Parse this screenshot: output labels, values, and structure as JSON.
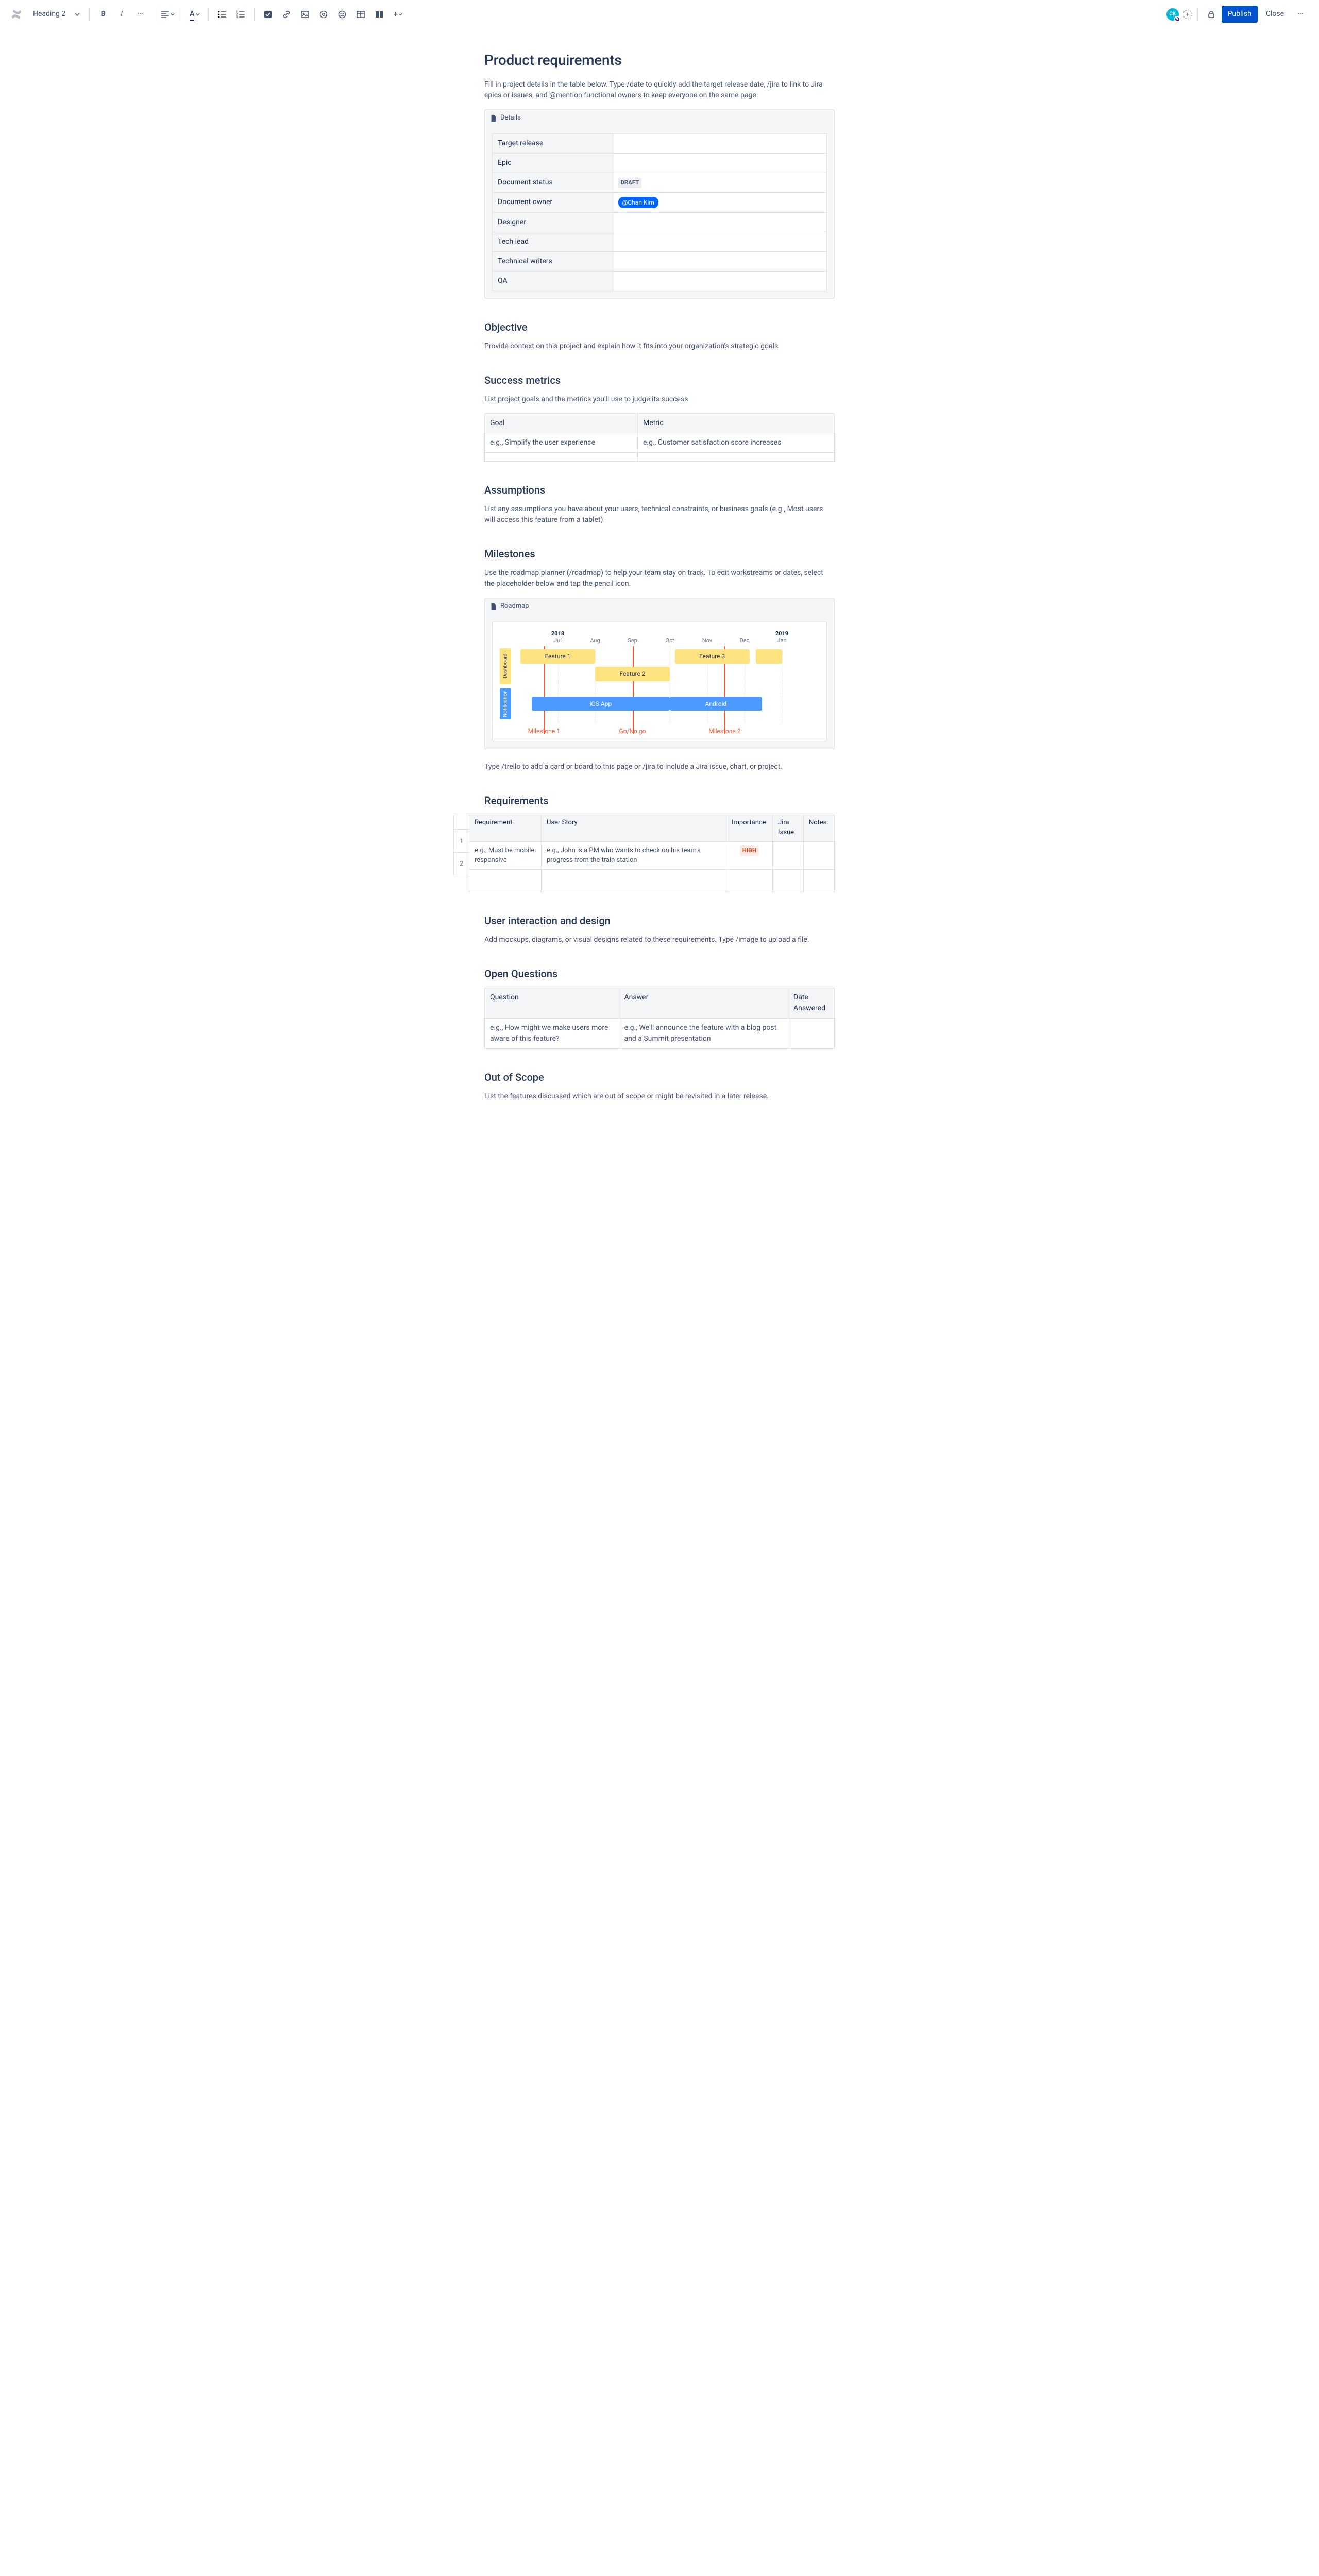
{
  "toolbar": {
    "style_select": "Heading 2",
    "publish": "Publish",
    "close": "Close",
    "avatar": "CK"
  },
  "title": "Product requirements",
  "intro": "Fill in project details in the table below. Type /date to quickly add the target release date, /jira to link to Jira epics or issues, and @mention functional owners to keep everyone on the same page.",
  "details": {
    "panel_label": "Details",
    "rows": [
      {
        "k": "Target release",
        "v": ""
      },
      {
        "k": "Epic",
        "v": ""
      },
      {
        "k": "Document status",
        "status": "DRAFT"
      },
      {
        "k": "Document owner",
        "mention": "@Chan Kim"
      },
      {
        "k": "Designer",
        "v": ""
      },
      {
        "k": "Tech lead",
        "v": ""
      },
      {
        "k": "Technical writers",
        "v": ""
      },
      {
        "k": "QA",
        "v": ""
      }
    ]
  },
  "objective": {
    "h": "Objective",
    "p": "Provide context on this project and explain how it fits into your organization's strategic goals"
  },
  "success": {
    "h": "Success metrics",
    "p": "List project goals and the metrics you'll use to judge its success",
    "cols": [
      "Goal",
      "Metric"
    ],
    "rows": [
      [
        "e.g., Simplify the user experience",
        "e.g., Customer satisfaction score increases"
      ],
      [
        "",
        ""
      ]
    ]
  },
  "assumptions": {
    "h": "Assumptions",
    "p": "List any assumptions you have about your users, technical constraints, or business goals (e.g., Most users will access this feature from a tablet)"
  },
  "milestones": {
    "h": "Milestones",
    "p": "Use the roadmap planner (/roadmap) to help your team stay on track. To edit workstreams or dates, select the placeholder below and tap the pencil icon.",
    "panel_label": "Roadmap",
    "after": "Type /trello to add a card or board to this page or /jira to include a Jira issue, chart, or project."
  },
  "chart_data": {
    "type": "gantt",
    "x_unit": "month",
    "months": [
      "Jul",
      "Aug",
      "Sep",
      "Oct",
      "Nov",
      "Dec",
      "Jan"
    ],
    "years": [
      {
        "label": "2018",
        "at": "Jul"
      },
      {
        "label": "2019",
        "at": "Jan"
      }
    ],
    "lanes": [
      {
        "name": "Dashboard",
        "color": "#FFE380",
        "bars": [
          {
            "label": "Feature 1",
            "start": "2018-06-20",
            "end": "2018-09-01"
          },
          {
            "label": "Feature 2",
            "start": "2018-09-01",
            "end": "2018-11-01"
          },
          {
            "label": "Feature 3",
            "start": "2018-11-05",
            "end": "2019-01-05"
          },
          {
            "label": "",
            "start": "2019-01-10",
            "end": "2019-02-01"
          }
        ]
      },
      {
        "name": "Notification",
        "color": "#4C9AFF",
        "bars": [
          {
            "label": "iOS App",
            "start": "2018-07-10",
            "end": "2018-11-01"
          },
          {
            "label": "Android",
            "start": "2018-11-01",
            "end": "2019-01-15"
          }
        ]
      }
    ],
    "milestones": [
      {
        "label": "Milestone 1",
        "at": "2018-07-20"
      },
      {
        "label": "Go/No go",
        "at": "2018-10-01"
      },
      {
        "label": "Milestone 2",
        "at": "2018-12-15"
      }
    ]
  },
  "requirements": {
    "h": "Requirements",
    "cols": [
      "Requirement",
      "User Story",
      "Importance",
      "Jira Issue",
      "Notes"
    ],
    "rows": [
      {
        "n": "1",
        "cells": [
          "e.g., Must be mobile responsive",
          "e.g., John is a PM who wants to check on his team's progress from the train station",
          "HIGH",
          "",
          ""
        ]
      },
      {
        "n": "2",
        "cells": [
          "",
          "",
          "",
          "",
          ""
        ]
      }
    ]
  },
  "uidesign": {
    "h": "User interaction and design",
    "p": "Add mockups, diagrams, or visual designs related to these requirements. Type /image to upload a file."
  },
  "openq": {
    "h": "Open Questions",
    "cols": [
      "Question",
      "Answer",
      "Date Answered"
    ],
    "rows": [
      [
        "e.g., How might we make users more aware of this feature?",
        "e.g., We'll announce the feature with a blog post and a Summit presentation",
        ""
      ]
    ]
  },
  "scope": {
    "h": "Out of Scope",
    "p": "List the features discussed which are out of scope or might be revisited in a later release."
  }
}
